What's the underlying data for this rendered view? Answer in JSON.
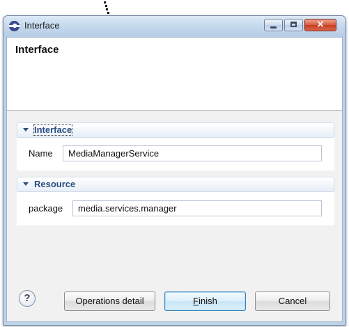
{
  "window": {
    "title": "Interface",
    "controls": {
      "minimize": "minimize",
      "maximize": "maximize",
      "close": "close"
    }
  },
  "header": {
    "title": "Interface"
  },
  "sections": [
    {
      "label": "Interface",
      "field": {
        "label": "Name",
        "value": "MediaManagerService"
      }
    },
    {
      "label": "Resource",
      "field": {
        "label": "package",
        "value": "media.services.manager"
      }
    }
  ],
  "footer": {
    "help": "?",
    "operations_label": "Operations detail",
    "finish": {
      "mnemonic": "F",
      "rest": "inish"
    },
    "cancel_label": "Cancel"
  },
  "colors": {
    "section_title": "#2b4c80",
    "close_button": "#c43d22",
    "default_button_border": "#3c7fb1"
  },
  "icons": [
    "eclipse-app-icon",
    "minimize-icon",
    "maximize-icon",
    "close-icon",
    "collapse-triangle-icon",
    "help-icon"
  ]
}
